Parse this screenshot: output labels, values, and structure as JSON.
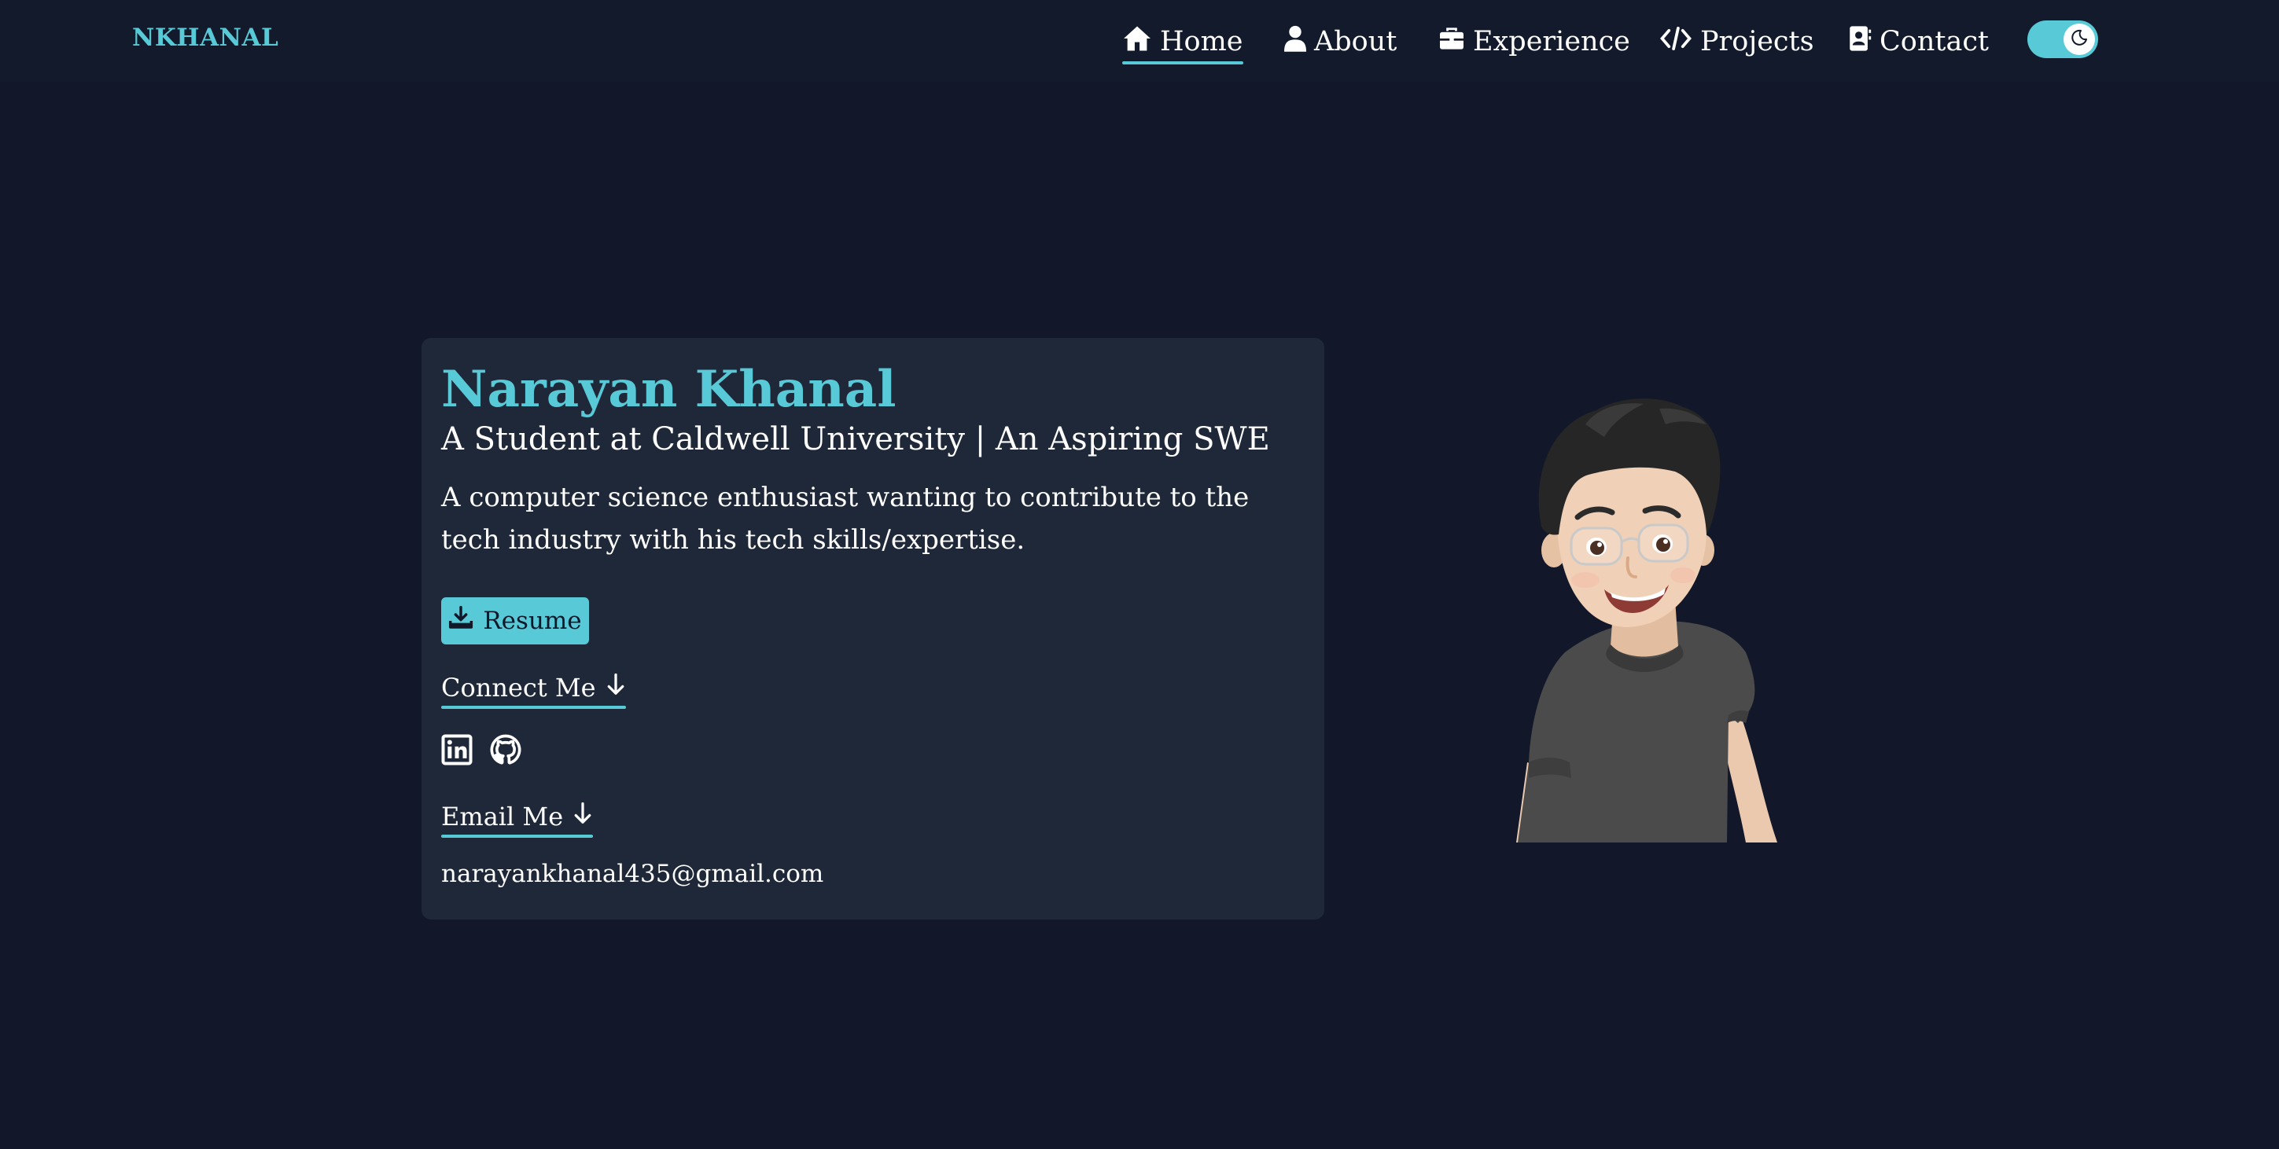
{
  "navbar": {
    "brand": "NKHANAL",
    "items": [
      {
        "label": "Home",
        "icon": "home-icon",
        "active": true
      },
      {
        "label": "About",
        "icon": "user-icon",
        "active": false
      },
      {
        "label": "Experience",
        "icon": "briefcase-icon",
        "active": false
      },
      {
        "label": "Projects",
        "icon": "code-icon",
        "active": false
      },
      {
        "label": "Contact",
        "icon": "contact-card-icon",
        "active": false
      }
    ],
    "theme_toggle": {
      "icon": "moon-icon",
      "state": "dark"
    }
  },
  "hero": {
    "name": "Narayan Khanal",
    "subtitle": "A Student at Caldwell University | An Aspiring SWE",
    "description": "A computer science enthusiast wanting to contribute to the tech industry with his tech skills/expertise.",
    "resume_button": {
      "label": "Resume",
      "icon": "download-icon"
    },
    "connect_heading": "Connect Me",
    "socials": [
      {
        "name": "LinkedIn",
        "icon": "linkedin-icon"
      },
      {
        "name": "GitHub",
        "icon": "github-icon"
      }
    ],
    "email_heading": "Email Me",
    "email": "narayankhanal435@gmail.com"
  },
  "avatar": {
    "icon": "memoji-avatar"
  },
  "colors": {
    "background": "#121829",
    "card": "#1f2838",
    "accent": "#58c9d6",
    "text": "#ffffff"
  }
}
